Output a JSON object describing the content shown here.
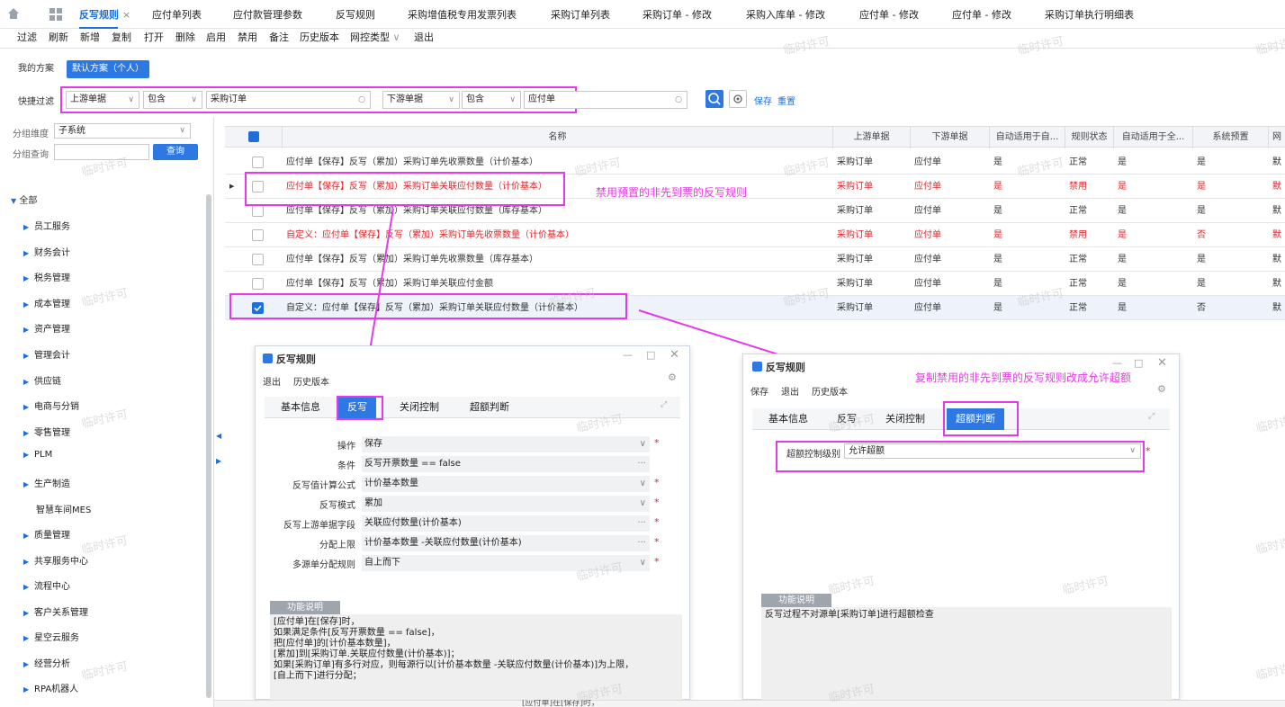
{
  "tabs": [
    "反写规则",
    "应付单列表",
    "应付款管理参数",
    "反写规则",
    "采购增值税专用发票列表",
    "采购订单列表",
    "采购订单 - 修改",
    "采购入库单 - 修改",
    "应付单 - 修改",
    "应付单 - 修改",
    "采购订单执行明细表"
  ],
  "tab_close": "×",
  "toolbar": [
    "过滤",
    "刷新",
    "新增",
    "复制",
    "打开",
    "删除",
    "启用",
    "禁用",
    "备注",
    "历史版本",
    "网控类型",
    "退出"
  ],
  "schemes": {
    "mine": "我的方案",
    "default": "默认方案（个人）"
  },
  "quick_filter": {
    "label": "快捷过滤",
    "field1": "上游单据",
    "op1": "包含",
    "value1": "采购订单",
    "field2": "下游单据",
    "op2": "包含",
    "value2": "应付单",
    "save": "保存",
    "reset": "重置"
  },
  "left": {
    "group_dim_label": "分组维度",
    "group_dim_value": "子系统",
    "group_query_label": "分组查询",
    "query_btn": "查询",
    "tree_root": "全部",
    "tree": [
      "员工服务",
      "财务会计",
      "税务管理",
      "成本管理",
      "资产管理",
      "管理会计",
      "供应链",
      "电商与分销",
      "零售管理",
      "PLM",
      "生产制造",
      "智慧车间MES",
      "质量管理",
      "共享服务中心",
      "流程中心",
      "客户关系管理",
      "星空云服务",
      "经营分析",
      "RPA机器人"
    ]
  },
  "grid": {
    "headers": [
      "名称",
      "上游单据",
      "下游单据",
      "自动适用于自...",
      "规则状态",
      "自动适用于全...",
      "系统预置",
      "网"
    ],
    "rows": [
      {
        "name": "应付单【保存】反写（累加）采购订单先收票数量（计价基本）",
        "up": "采购订单",
        "down": "应付单",
        "auto1": "是",
        "status": "正常",
        "auto2": "是",
        "preset": "是",
        "net": "默",
        "red": false,
        "checked": false
      },
      {
        "name": "应付单【保存】反写（累加）采购订单关联应付数量（计价基本）",
        "up": "采购订单",
        "down": "应付单",
        "auto1": "是",
        "status": "禁用",
        "auto2": "是",
        "preset": "是",
        "net": "默",
        "red": true,
        "checked": false
      },
      {
        "name": "应付单【保存】反写（累加）采购订单关联应付数量（库存基本）",
        "up": "采购订单",
        "down": "应付单",
        "auto1": "是",
        "status": "正常",
        "auto2": "是",
        "preset": "是",
        "net": "默",
        "red": false,
        "checked": false
      },
      {
        "name": "自定义：应付单【保存】反写（累加）采购订单先收票数量（计价基本）",
        "up": "采购订单",
        "down": "应付单",
        "auto1": "是",
        "status": "禁用",
        "auto2": "是",
        "preset": "否",
        "net": "默",
        "red": true,
        "checked": false
      },
      {
        "name": "应付单【保存】反写（累加）采购订单先收票数量（库存基本）",
        "up": "采购订单",
        "down": "应付单",
        "auto1": "是",
        "status": "正常",
        "auto2": "是",
        "preset": "是",
        "net": "默",
        "red": false,
        "checked": false
      },
      {
        "name": "应付单【保存】反写（累加）采购订单关联应付金额",
        "up": "采购订单",
        "down": "应付单",
        "auto1": "是",
        "status": "正常",
        "auto2": "是",
        "preset": "是",
        "net": "默",
        "red": false,
        "checked": false
      },
      {
        "name": "自定义：应付单【保存】反写（累加）采购订单关联应付数量（计价基本）",
        "up": "采购订单",
        "down": "应付单",
        "auto1": "是",
        "status": "正常",
        "auto2": "是",
        "preset": "否",
        "net": "默",
        "red": false,
        "checked": true
      }
    ]
  },
  "annotations": {
    "a1": "禁用预置的非先到票的反写规则",
    "a2": "复制禁用的非先到票的反写规则改成允许超额"
  },
  "dialog1": {
    "title": "反写规则",
    "menu": [
      "退出",
      "历史版本"
    ],
    "tabs": [
      "基本信息",
      "反写",
      "关闭控制",
      "超额判断"
    ],
    "fields": [
      {
        "label": "操作",
        "value": "保存",
        "kind": "select",
        "req": true
      },
      {
        "label": "条件",
        "value": "反写开票数量 == false",
        "kind": "more",
        "req": false
      },
      {
        "label": "反写值计算公式",
        "value": "计价基本数量",
        "kind": "select",
        "req": true
      },
      {
        "label": "反写模式",
        "value": "累加",
        "kind": "select",
        "req": true
      },
      {
        "label": "反写上游单据字段",
        "value": "关联应付数量(计价基本)",
        "kind": "more",
        "req": true
      },
      {
        "label": "分配上限",
        "value": "计价基本数量 -关联应付数量(计价基本)",
        "kind": "more",
        "req": true
      },
      {
        "label": "多源单分配规则",
        "value": "自上而下",
        "kind": "select",
        "req": true
      }
    ],
    "desc_title": "功能说明",
    "desc": "[应付单]在[保存]时，\n如果满足条件[反写开票数量 == false]，\n把[应付单]的[计价基本数量]，\n[累加]到[采购订单.关联应付数量(计价基本)]；\n如果[采购订单]有多行对应，则每源行以[计价基本数量 -关联应付数量(计价基本)]为上限，\n[自上而下]进行分配；"
  },
  "dialog2": {
    "title": "反写规则",
    "menu": [
      "保存",
      "退出",
      "历史版本"
    ],
    "tabs": [
      "基本信息",
      "反写",
      "关闭控制",
      "超额判断"
    ],
    "field_label": "超额控制级别",
    "field_value": "允许超额",
    "desc_title": "功能说明",
    "desc": "反写过程不对源单[采购订单]进行超额检查"
  },
  "watermark": "临时许可",
  "bottom_text": "[应付单]在[保存]时，",
  "colors": {
    "accent": "#1e6fd9",
    "annotation": "#e63ae6",
    "red": "#e0242a"
  }
}
